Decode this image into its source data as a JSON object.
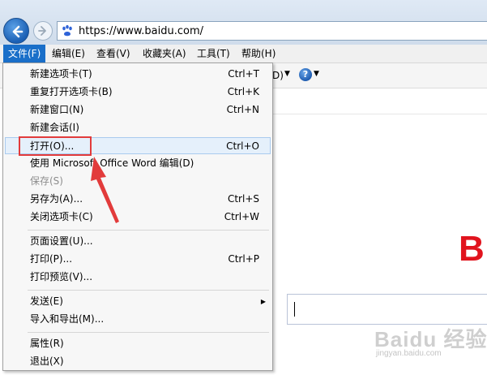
{
  "browser": {
    "address": "https://www.baidu.com/"
  },
  "menubar": {
    "items": [
      {
        "label": "文件(F)"
      },
      {
        "label": "编辑(E)"
      },
      {
        "label": "查看(V)"
      },
      {
        "label": "收藏夹(A)"
      },
      {
        "label": "工具(T)"
      },
      {
        "label": "帮助(H)"
      }
    ]
  },
  "cmdbar": {
    "fragment": "D)",
    "help_glyph": "?"
  },
  "file_menu": {
    "items": [
      {
        "label": "新建选项卡(T)",
        "shortcut": "Ctrl+T"
      },
      {
        "label": "重复打开选项卡(B)",
        "shortcut": "Ctrl+K"
      },
      {
        "label": "新建窗口(N)",
        "shortcut": "Ctrl+N"
      },
      {
        "label": "新建会话(I)",
        "shortcut": ""
      },
      {
        "label": "打开(O)...",
        "shortcut": "Ctrl+O",
        "state": "hover"
      },
      {
        "label": "使用 Microsoft Office Word 编辑(D)",
        "shortcut": ""
      },
      {
        "label": "保存(S)",
        "shortcut": "",
        "state": "disabled"
      },
      {
        "label": "另存为(A)...",
        "shortcut": "Ctrl+S"
      },
      {
        "label": "关闭选项卡(C)",
        "shortcut": "Ctrl+W"
      },
      {
        "label": "页面设置(U)...",
        "shortcut": ""
      },
      {
        "label": "打印(P)...",
        "shortcut": "Ctrl+P"
      },
      {
        "label": "打印预览(V)...",
        "shortcut": ""
      },
      {
        "label": "发送(E)",
        "shortcut": "",
        "submenu": true
      },
      {
        "label": "导入和导出(M)...",
        "shortcut": ""
      },
      {
        "label": "属性(R)",
        "shortcut": ""
      },
      {
        "label": "退出(X)",
        "shortcut": ""
      }
    ]
  },
  "page": {
    "logo_fragment": "B"
  },
  "watermark": {
    "main": "Baidu 经验",
    "sub": "jingyan.baidu.com"
  },
  "colors": {
    "highlight": "#e23b3b",
    "menu_active": "#1a6fc9"
  }
}
